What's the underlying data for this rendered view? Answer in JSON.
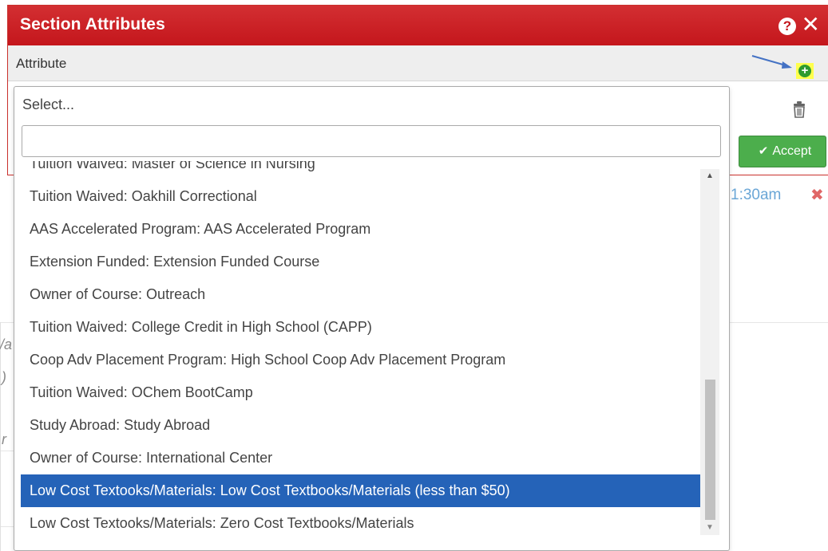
{
  "modal": {
    "title": "Section Attributes",
    "attribute_label": "Attribute",
    "help_glyph": "?",
    "close_glyph": "✕",
    "add_glyph": "+",
    "accept_label": "Accept",
    "icons": [
      "help-icon",
      "close-icon",
      "add-icon",
      "trash-icon",
      "check-icon",
      "arrow-annotation"
    ]
  },
  "background": {
    "time_text": "1:30am",
    "delete_glyph": "✖",
    "fragment_a": "/a",
    "fragment_b": ")",
    "fragment_c": "r"
  },
  "dropdown": {
    "selected_display": "Select...",
    "search_value": "",
    "options": [
      "Tuition Waived: Master of Science in Nursing",
      "Tuition Waived: Oakhill Correctional",
      "AAS Accelerated Program: AAS Accelerated Program",
      "Extension Funded: Extension Funded Course",
      "Owner of Course: Outreach",
      "Tuition Waived: College Credit in High School (CAPP)",
      "Coop Adv Placement Program: High School Coop Adv Placement Program",
      "Tuition Waived: OChem BootCamp",
      "Study Abroad: Study Abroad",
      "Owner of Course: International Center",
      "Low Cost Textooks/Materials: Low Cost Textbooks/Materials (less than $50)",
      "Low Cost Textooks/Materials: Zero Cost Textbooks/Materials"
    ],
    "highlighted_option": "Low Cost Textooks/Materials: Low Cost Textbooks/Materials (less than $50)"
  },
  "colors": {
    "header_red": "#c4161c",
    "accept_green": "#4cae4c",
    "highlight_blue": "#2563b8",
    "add_highlight": "#ffff4d",
    "arrow_blue": "#4472c4"
  }
}
